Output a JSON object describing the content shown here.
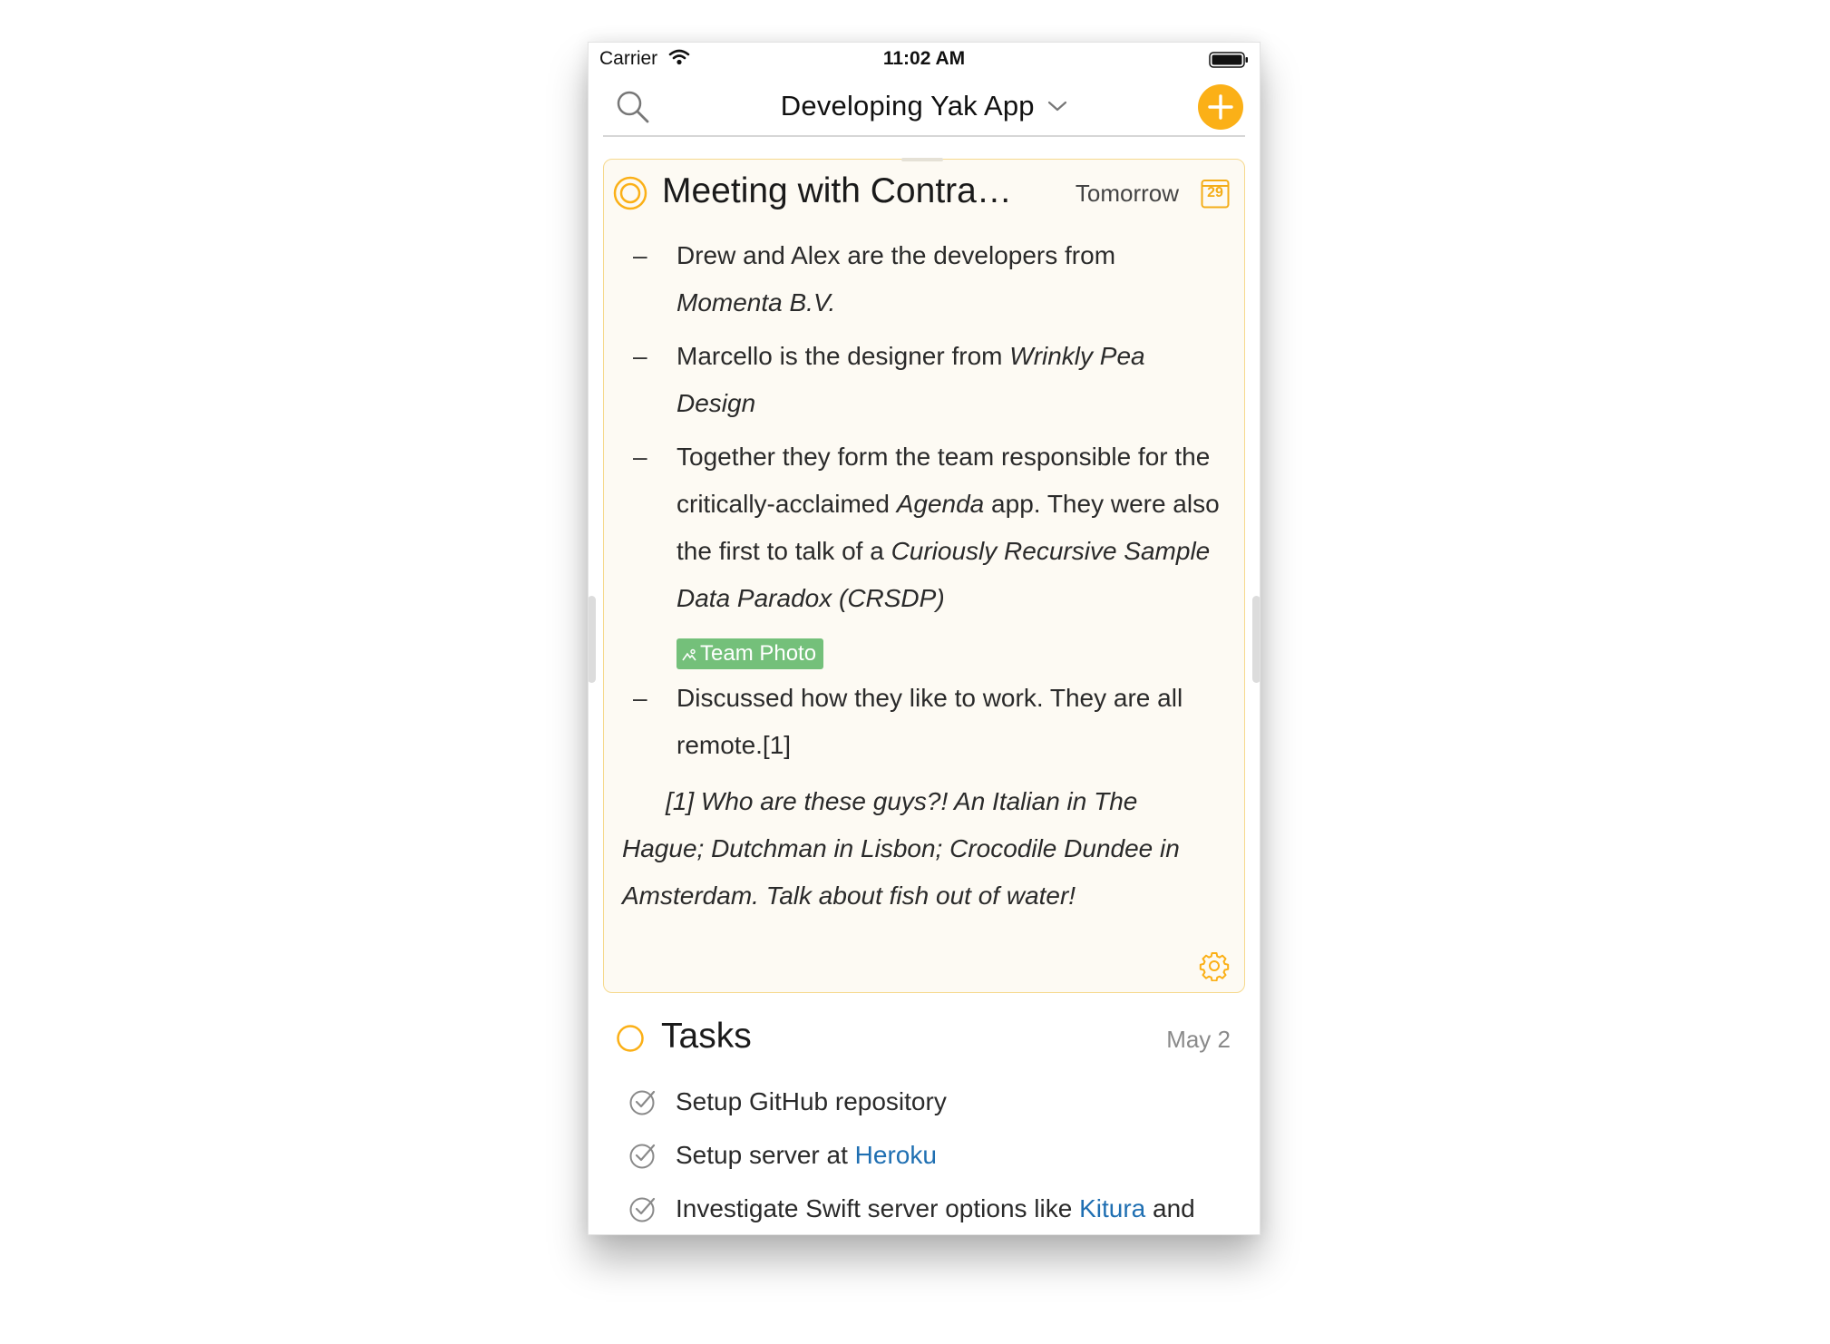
{
  "status_bar": {
    "carrier": "Carrier",
    "time": "11:02 AM"
  },
  "nav": {
    "title": "Developing Yak App"
  },
  "note": {
    "title": "Meeting with Contra…",
    "date": "Tomorrow",
    "calendar_day": "29",
    "bullets": [
      {
        "a": "Drew and Alex are the developers from ",
        "b": "Momenta B.V.",
        "c": "",
        "d": "",
        "e": ""
      },
      {
        "a": "Marcello is the designer from ",
        "b": "Wrinkly Pea Design",
        "c": "",
        "d": "",
        "e": ""
      },
      {
        "a": "Together they form the team responsible for the critically-acclaimed ",
        "b": "Agenda",
        "c": " app. They were also the first to talk of a ",
        "d": "Curiously Recursive Sample Data Paradox (CRSDP)",
        "e": ""
      },
      {
        "a": "Discussed how they like to work. They are all remote.[1]",
        "b": "",
        "c": "",
        "d": "",
        "e": ""
      }
    ],
    "attachment_label": "Team Photo",
    "footnote": "[1] Who are these guys?! An Italian in The Hague; Dutchman in Lisbon; Crocodile Dundee in Amsterdam. Talk about fish out of water!"
  },
  "tasks_note": {
    "title": "Tasks",
    "date": "May 2",
    "items": [
      {
        "text": "Setup GitHub repository",
        "link": "",
        "after": ""
      },
      {
        "text": "Setup server at ",
        "link": "Heroku",
        "after": ""
      },
      {
        "text": "Investigate Swift server options like ",
        "link": "Kitura",
        "after": " and"
      }
    ]
  },
  "colors": {
    "accent": "#fbb017",
    "card_background": "#fdfaf3",
    "card_border": "#f6d98d",
    "attachment_tag": "#74c07a",
    "link": "#1f6fb2"
  },
  "icons": [
    "wifi-icon",
    "battery-icon",
    "search-icon",
    "chevron-down-icon",
    "plus-icon",
    "status-ring-icon",
    "calendar-icon",
    "photo-icon",
    "gear-icon",
    "checkmark-circle-icon"
  ]
}
